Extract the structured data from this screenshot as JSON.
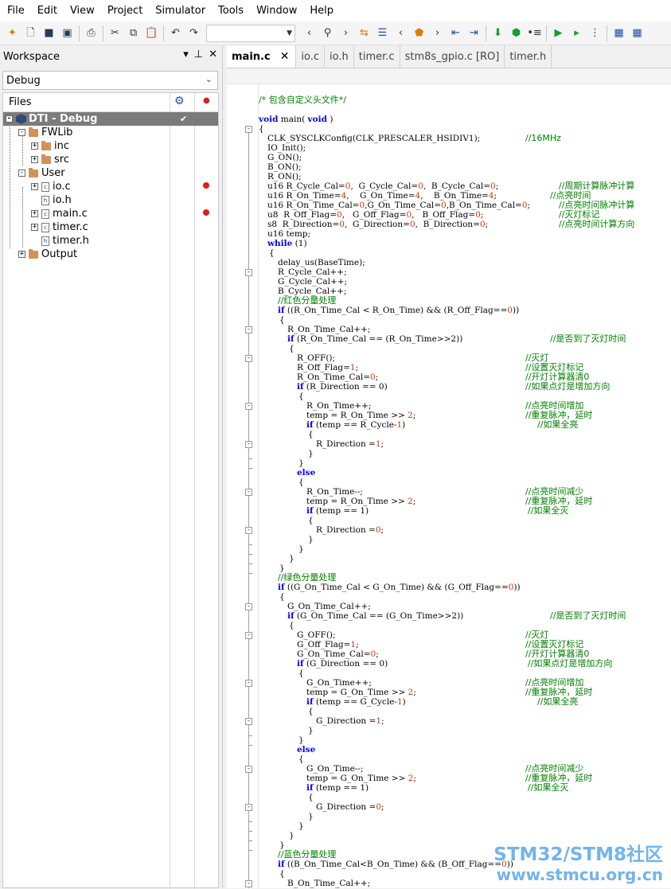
{
  "menubar": {
    "items": [
      "File",
      "Edit",
      "View",
      "Project",
      "Simulator",
      "Tools",
      "Window",
      "Help"
    ]
  },
  "toolbar": {
    "search_value": ""
  },
  "workspace": {
    "title": "Workspace",
    "config": "Debug",
    "files_header": "Files",
    "tree": {
      "project": "DTI - Debug",
      "fwlib": "FWLib",
      "inc": "inc",
      "src": "src",
      "user": "User",
      "io_c": "io.c",
      "io_h": "io.h",
      "main_c": "main.c",
      "timer_c": "timer.c",
      "timer_h": "timer.h",
      "output": "Output"
    }
  },
  "tabs": [
    "main.c",
    "io.c",
    "io.h",
    "timer.c",
    "stm8s_gpio.c [RO]",
    "timer.h"
  ],
  "code": {
    "l0": "/* 包含自定义头文件*/",
    "l1_kw": "void",
    "l1_mid": " main( ",
    "l1_kw2": "void",
    "l1_end": " )",
    "l2": "{",
    "l3": "CLK_SYSCLKConfig(CLK_PRESCALER_HSIDIV1);",
    "l3c": "//16MHz",
    "l4": "IO_Init();",
    "l5": "G_ON();",
    "l6": "B_ON();",
    "l7": "R_ON();",
    "l8": "u16 R_Cycle_Cal=0,  G_Cycle_Cal=0,  B_Cycle_Cal=0;",
    "l8c": "//周期计算脉冲计算",
    "l9": "u16 R_On_Time=4,    G_On_Time=4,    B_On_Time=4;",
    "l9c": "//点亮时间",
    "l10": "u16 R_On_Time_Cal=0,G_On_Time_Cal=0,B_On_Time_Cal=0;",
    "l10c": "//点亮时间脉冲计算",
    "l11": "u8  R_Off_Flag=0,   G_Off_Flag=0,   B_Off_Flag=0;",
    "l11c": "//灭灯标记",
    "l12": "s8  R_Direction=0,  G_Direction=0,  B_Direction=0;",
    "l12c": "//点亮时间计算方向",
    "l13": "u16 temp;",
    "l14_kw": "while",
    "l14_end": " (1)",
    "l15": "{",
    "l16": "delay_us(BaseTime);",
    "l17": "R_Cycle_Cal++;",
    "l18": "G_Cycle_Cal++;",
    "l19": "B_Cycle_Cal++;",
    "l20": "//红色分量处理",
    "l21": "if ((R_On_Time_Cal < R_On_Time) && (R_Off_Flag==0))",
    "l22": "{",
    "l23": "R_On_Time_Cal++;",
    "l24": "if (R_On_Time_Cal == (R_On_Time>>2))",
    "l24c": "//是否到了灭灯时间",
    "l25": "{",
    "l26": "R_OFF();",
    "l26c": "//灭灯",
    "l27": "R_Off_Flag=1;",
    "l27c": "//设置灭灯标记",
    "l28": "R_On_Time_Cal=0;",
    "l28c": "//开灯计算器清0",
    "l29": "if (R_Direction == 0)",
    "l29c": "//如果点灯是增加方向",
    "l30": "{",
    "l31": "R_On_Time++;",
    "l31c": "//点亮时间增加",
    "l32": "temp = R_On_Time >> 2;",
    "l32c": "//重复脉冲，延时",
    "l33": "if (temp == R_Cycle-1)",
    "l33c": "//如果全亮",
    "l34": "{",
    "l35": "R_Direction =1;",
    "l36": "}",
    "l37": "}",
    "l38": "else",
    "l39": "{",
    "l40": "R_On_Time--;",
    "l40c": "//点亮时间减少",
    "l41": "temp = R_On_Time >> 2;",
    "l41c": "//重复脉冲，延时",
    "l42": "if (temp == 1)",
    "l42c": "//如果全灭",
    "l43": "{",
    "l44": "R_Direction =0;",
    "l45": "}",
    "l46": "}",
    "l47": "}",
    "l48": "}",
    "l49": "//绿色分量处理",
    "l50": "if ((G_On_Time_Cal < G_On_Time) && (G_Off_Flag==0))",
    "l51": "{",
    "l52": "G_On_Time_Cal++;",
    "l53": "if (G_On_Time_Cal == (G_On_Time>>2))",
    "l53c": "//是否到了灭灯时间",
    "l54": "{",
    "l55": "G_OFF();",
    "l55c": "//灭灯",
    "l56": "G_Off_Flag=1;",
    "l56c": "//设置灭灯标记",
    "l57": "G_On_Time_Cal=0;",
    "l57c": "//开灯计算器清0",
    "l58": "if (G_Direction == 0)",
    "l58c": "//如果点灯是增加方向",
    "l59": "{",
    "l60": "G_On_Time++;",
    "l60c": "//点亮时间增加",
    "l61": "temp = G_On_Time >> 2;",
    "l61c": "//重复脉冲，延时",
    "l62": "if (temp == G_Cycle-1)",
    "l62c": "//如果全亮",
    "l63": "{",
    "l64": "G_Direction =1;",
    "l65": "}",
    "l66": "}",
    "l67": "else",
    "l68": "{",
    "l69": "G_On_Time--;",
    "l69c": "//点亮时间减少",
    "l70": "temp = G_On_Time >> 2;",
    "l70c": "//重复脉冲，延时",
    "l71": "if (temp == 1)",
    "l71c": "//如果全灭",
    "l72": "{",
    "l73": "G_Direction =0;",
    "l74": "}",
    "l75": "}",
    "l76": "}",
    "l77": "}",
    "l78": "//蓝色分量处理",
    "l79": "if ((B_On_Time_Cal<B_On_Time) && (B_Off_Flag==0))",
    "l80": "{",
    "l81": "B_On_Time_Cal++;"
  },
  "watermark": {
    "line1": "STM32/STM8社区",
    "line2": "www.stmcu.org.cn"
  },
  "colors": {
    "keyword": "#0000ff",
    "comment": "#008000",
    "number": "#d23200",
    "selection": "#7b7b7b",
    "breakpoint": "#e01c1c"
  }
}
